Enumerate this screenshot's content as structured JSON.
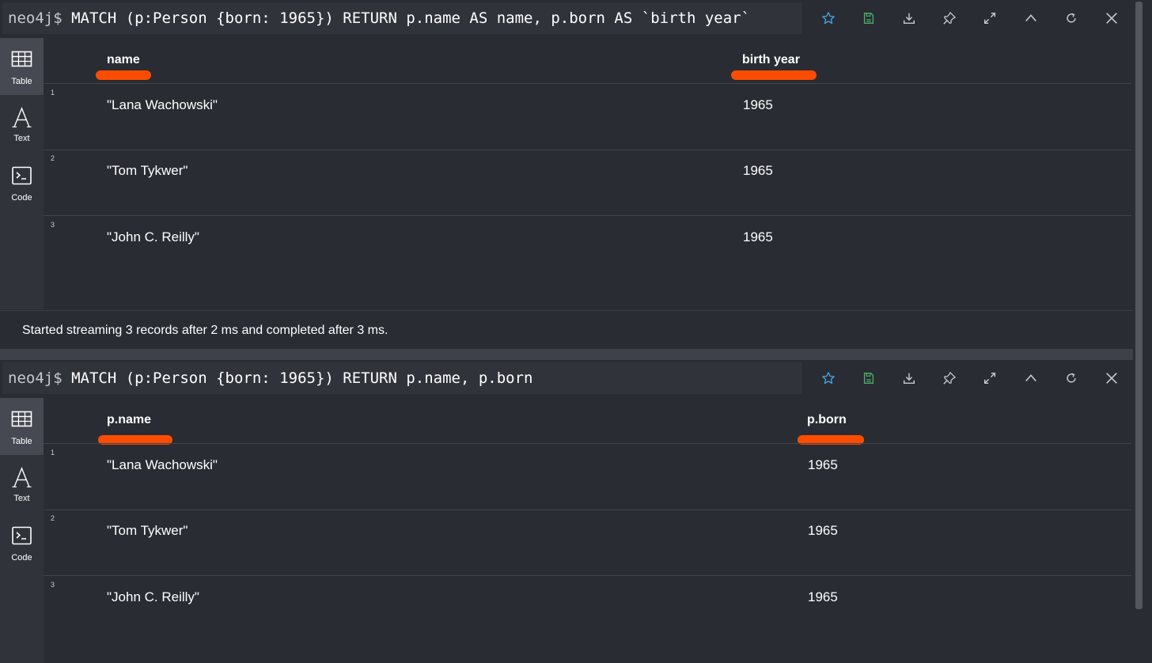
{
  "frames": [
    {
      "query": {
        "prompt": "neo4j$",
        "text": "MATCH (p:Person {born: 1965}) RETURN p.name AS name, p.born AS `birth year`"
      },
      "sidebar": {
        "table": "Table",
        "text": "Text",
        "code": "Code"
      },
      "columns": [
        "name",
        "birth year"
      ],
      "rows": [
        {
          "num": "1",
          "cells": [
            "\"Lana Wachowski\"",
            "1965"
          ]
        },
        {
          "num": "2",
          "cells": [
            "\"Tom Tykwer\"",
            "1965"
          ]
        },
        {
          "num": "3",
          "cells": [
            "\"John C. Reilly\"",
            "1965"
          ]
        }
      ],
      "status": "Started streaming 3 records after 2 ms and completed after 3 ms."
    },
    {
      "query": {
        "prompt": "neo4j$",
        "text": "MATCH (p:Person {born: 1965}) RETURN p.name, p.born"
      },
      "sidebar": {
        "table": "Table",
        "text": "Text",
        "code": "Code"
      },
      "columns": [
        "p.name",
        "p.born"
      ],
      "rows": [
        {
          "num": "1",
          "cells": [
            "\"Lana Wachowski\"",
            "1965"
          ]
        },
        {
          "num": "2",
          "cells": [
            "\"Tom Tykwer\"",
            "1965"
          ]
        },
        {
          "num": "3",
          "cells": [
            "\"John C. Reilly\"",
            "1965"
          ]
        }
      ]
    }
  ],
  "toolbar_icons": [
    "star-icon",
    "save-icon",
    "download-icon",
    "pin-icon",
    "expand-icon",
    "collapse-icon",
    "rerun-icon",
    "close-icon"
  ],
  "colors": {
    "background": "#292c33",
    "panel": "#31333b",
    "active_tab": "#464951",
    "highlight_mark": "#fc4c02",
    "star_icon": "#4a9fdc",
    "save_icon": "#4cae6b",
    "icon_default": "#c7c9cf"
  }
}
